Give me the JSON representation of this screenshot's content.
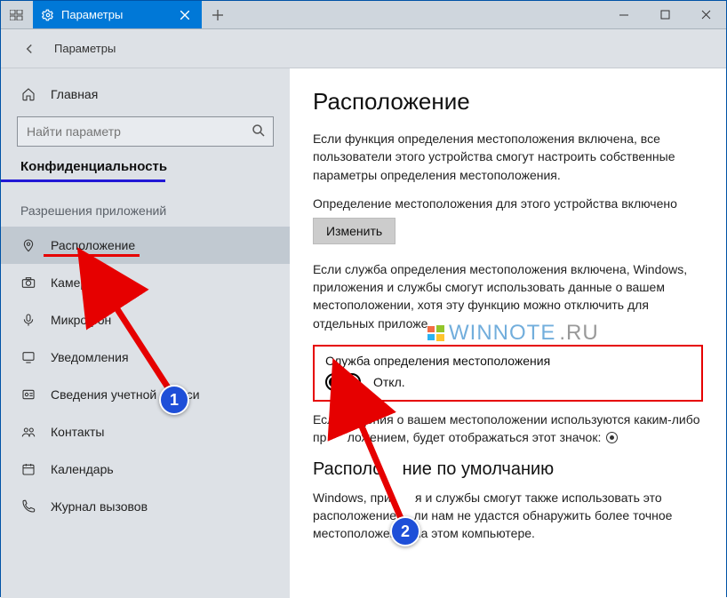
{
  "titlebar": {
    "tab_title": "Параметры",
    "crumb": "Параметры"
  },
  "sidebar": {
    "home": "Главная",
    "search_placeholder": "Найти параметр",
    "category": "Конфиденциальность",
    "section": "Разрешения приложений",
    "items": [
      "Расположение",
      "Камера",
      "Микрофон",
      "Уведомления",
      "Сведения учетной записи",
      "Контакты",
      "Календарь",
      "Журнал вызовов"
    ]
  },
  "content": {
    "title": "Расположение",
    "p1": "Если функция определения местоположения включена, все пользователи этого устройства смогут настроить собственные параметры определения местоположения.",
    "status_line": "Определение местоположения для этого устройства включено",
    "change_btn": "Изменить",
    "p2_a": "Если служба определения местоположения включена, Windows, приложения и службы смогут использовать данные о вашем местоположении, хотя эту функцию можно отключить для отдельных приложе",
    "toggle_label": "Служба определения местоположения",
    "toggle_state": "Откл.",
    "p3_a": "Есл",
    "p3_b": "дения о вашем местоположении используются каким-либо пр",
    "p3_c": "ложением, будет отображаться этот значок:",
    "section2": "Располо",
    "section2b": "ние по умолчанию",
    "p4_a": "Windows, при",
    "p4_b": "я и службы смогут также использовать это расположение,",
    "p4_c": "ли нам не удастся обнаружить более точное местоположение на этом компьютере."
  },
  "watermark": {
    "text1": "WINNOTE",
    "text2": ".RU"
  },
  "anno": {
    "b1": "1",
    "b2": "2"
  }
}
